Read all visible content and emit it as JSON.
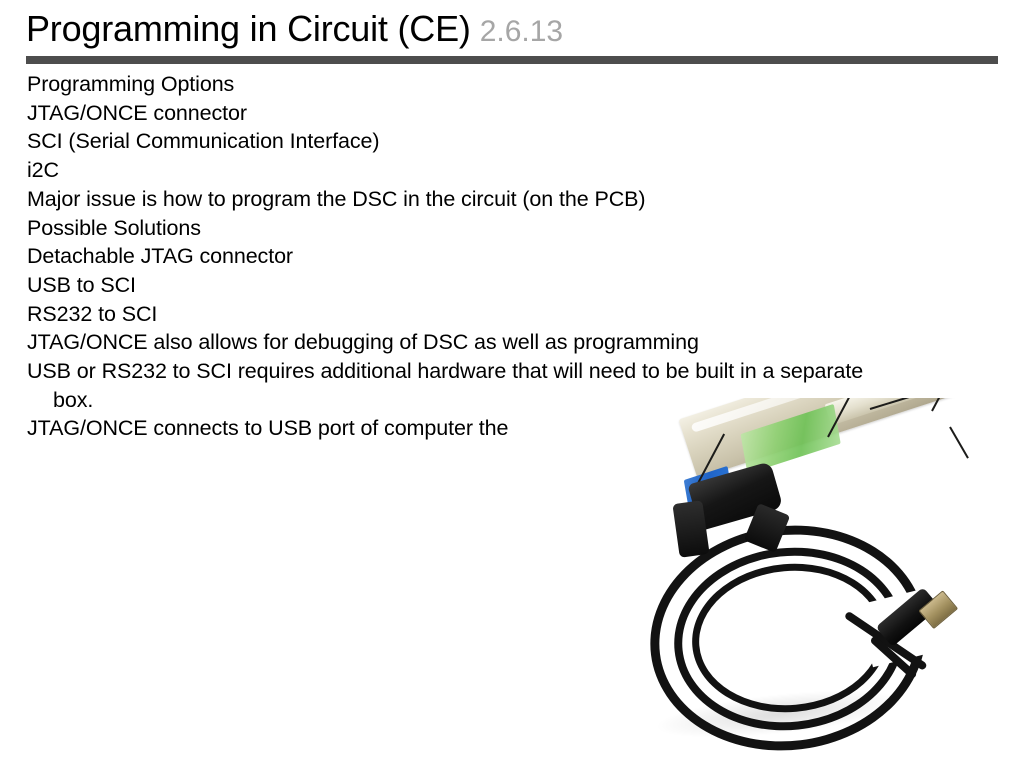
{
  "slide": {
    "title": "Programming in Circuit (CE)",
    "version": "2.6.13",
    "title_color": "#000000",
    "version_color": "#a6a6a6",
    "rule_color": "#4d4d4d",
    "background_color": "#ffffff",
    "body_lines": [
      {
        "text": "Programming Options",
        "indent": false
      },
      {
        "text": "JTAG/ONCE connector",
        "indent": false
      },
      {
        "text": "SCI (Serial Communication Interface)",
        "indent": false
      },
      {
        "text": "i2C",
        "indent": false
      },
      {
        "text": "Major issue is how to program the DSC in the circuit (on the PCB)",
        "indent": false
      },
      {
        "text": "Possible Solutions",
        "indent": false
      },
      {
        "text": "Detachable JTAG connector",
        "indent": false
      },
      {
        "text": "USB to SCI",
        "indent": false
      },
      {
        "text": "RS232 to SCI",
        "indent": false
      },
      {
        "text": "JTAG/ONCE also allows for debugging of DSC as well as programming",
        "indent": false
      },
      {
        "text": "USB or RS232 to SCI requires additional hardware that will need to be built in a separate",
        "indent": false
      },
      {
        "text": "box.",
        "indent": true
      },
      {
        "text": "JTAG/ONCE connects to USB port of computer the",
        "indent": false
      }
    ]
  },
  "photo": {
    "caption": "USB JTAG/ONCE programmer pod with coiled black cable and USB Type-A connector",
    "pod_body_color": "#d8d2bc",
    "pod_label_green_color": "#8fd173",
    "pod_label_blue_color": "#1f63c6",
    "cable_color": "#121212",
    "usb_contact_color": "#a2905f",
    "parts": [
      {
        "name": "pod-enclosure"
      },
      {
        "name": "pod-green-label"
      },
      {
        "name": "pod-blue-sticker"
      },
      {
        "name": "strain-relief-boot"
      },
      {
        "name": "coiled-cable"
      },
      {
        "name": "usb-type-a-plug"
      }
    ]
  }
}
